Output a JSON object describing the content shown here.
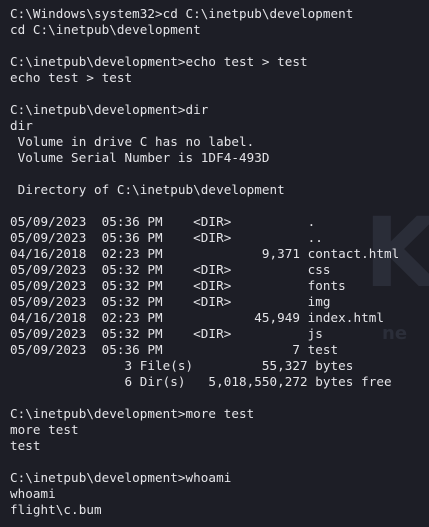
{
  "watermark": {
    "letter": "K",
    "subtext": "ne"
  },
  "terminal": {
    "lines": [
      "C:\\Windows\\system32>cd C:\\inetpub\\development",
      "cd C:\\inetpub\\development",
      "",
      "C:\\inetpub\\development>echo test > test",
      "echo test > test",
      "",
      "C:\\inetpub\\development>dir",
      "dir",
      " Volume in drive C has no label.",
      " Volume Serial Number is 1DF4-493D",
      "",
      " Directory of C:\\inetpub\\development",
      "",
      "05/09/2023  05:36 PM    <DIR>          .",
      "05/09/2023  05:36 PM    <DIR>          ..",
      "04/16/2018  02:23 PM             9,371 contact.html",
      "05/09/2023  05:32 PM    <DIR>          css",
      "05/09/2023  05:32 PM    <DIR>          fonts",
      "05/09/2023  05:32 PM    <DIR>          img",
      "04/16/2018  02:23 PM            45,949 index.html",
      "05/09/2023  05:32 PM    <DIR>          js",
      "05/09/2023  05:36 PM                 7 test",
      "               3 File(s)         55,327 bytes",
      "               6 Dir(s)   5,018,550,272 bytes free",
      "",
      "C:\\inetpub\\development>more test",
      "more test",
      "test",
      "",
      "C:\\inetpub\\development>whoami",
      "whoami",
      "flight\\c.bum"
    ]
  }
}
